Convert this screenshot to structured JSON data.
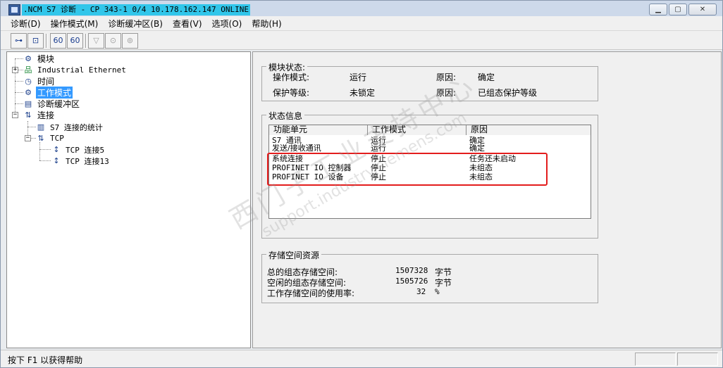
{
  "window": {
    "title": ".NCM S7 诊断 - CP 343-1 0/4 10.178.162.147  ONLINE",
    "minimize_icon": "minimize-icon",
    "maximize_icon": "maximize-icon",
    "close_icon": "close-icon"
  },
  "menu": {
    "items": [
      {
        "label": "诊断(D)"
      },
      {
        "label": "操作模式(M)"
      },
      {
        "label": "诊断缓冲区(B)"
      },
      {
        "label": "查看(V)"
      },
      {
        "label": "选项(O)"
      },
      {
        "label": "帮助(H)"
      }
    ]
  },
  "toolbar": {
    "buttons": [
      {
        "icon": "connect-icon",
        "glyph": "⊶"
      },
      {
        "icon": "disconnect-icon",
        "glyph": "⊡"
      },
      {
        "icon": "monitor-icon",
        "glyph": "60"
      },
      {
        "icon": "monitor-all-icon",
        "glyph": "60"
      },
      {
        "icon": "filter-icon",
        "glyph": "▽"
      },
      {
        "icon": "run-icon",
        "glyph": "⊙"
      },
      {
        "icon": "stop-icon",
        "glyph": "⊚"
      }
    ]
  },
  "tree": {
    "nodes": [
      {
        "label": "模块"
      },
      {
        "label": "Industrial Ethernet"
      },
      {
        "label": "时间"
      },
      {
        "label": "工作模式"
      },
      {
        "label": "诊断缓冲区"
      },
      {
        "label": "连接"
      },
      {
        "label": "S7 连接的统计"
      },
      {
        "label": "TCP"
      },
      {
        "label": "TCP 连接5"
      },
      {
        "label": "TCP 连接13"
      }
    ]
  },
  "module_status": {
    "title": "模块状态:",
    "rows": [
      {
        "label": "操作模式:",
        "value": "运行",
        "reason_label": "原因:",
        "reason": "确定"
      },
      {
        "label": "保护等级:",
        "value": "未锁定",
        "reason_label": "原因:",
        "reason": "已组态保护等级"
      }
    ]
  },
  "status_info": {
    "title": "状态信息",
    "columns": [
      "功能单元",
      "工作模式",
      "原因"
    ],
    "rows": [
      [
        "S7 通讯",
        "运行",
        "确定"
      ],
      [
        "发送/接收通讯",
        "运行",
        "确定"
      ],
      [
        "系统连接",
        "停止",
        "任务还未启动"
      ],
      [
        "PROFINET IO 控制器",
        "停止",
        "未组态"
      ],
      [
        "PROFINET IO 设备",
        "停止",
        "未组态"
      ]
    ]
  },
  "storage": {
    "title": "存储空间资源",
    "rows": [
      {
        "label": "总的组态存储空间:",
        "value": "1507328",
        "unit": "字节"
      },
      {
        "label": "空闲的组态存储空间:",
        "value": "1505726",
        "unit": "字节"
      },
      {
        "label": "工作存储空间的使用率:",
        "value": "32",
        "unit": "%"
      }
    ]
  },
  "watermark": {
    "cn": "西门子工业支持中心",
    "en": "support.industry.siemens.com"
  },
  "statusbar": {
    "text": "按下 F1 以获得帮助"
  }
}
